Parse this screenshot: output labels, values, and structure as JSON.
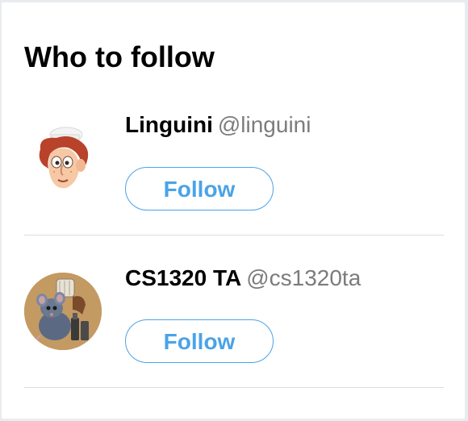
{
  "widget": {
    "title": "Who to follow"
  },
  "suggestions": [
    {
      "name": "Linguini",
      "handle": "@linguini",
      "follow_label": "Follow",
      "avatar": "linguini-avatar"
    },
    {
      "name": "CS1320 TA",
      "handle": "@cs1320ta",
      "follow_label": "Follow",
      "avatar": "remy-rat-avatar"
    }
  ],
  "colors": {
    "accent": "#4aa3e8",
    "handle": "#7c7c7c",
    "divider": "#dddddd"
  }
}
